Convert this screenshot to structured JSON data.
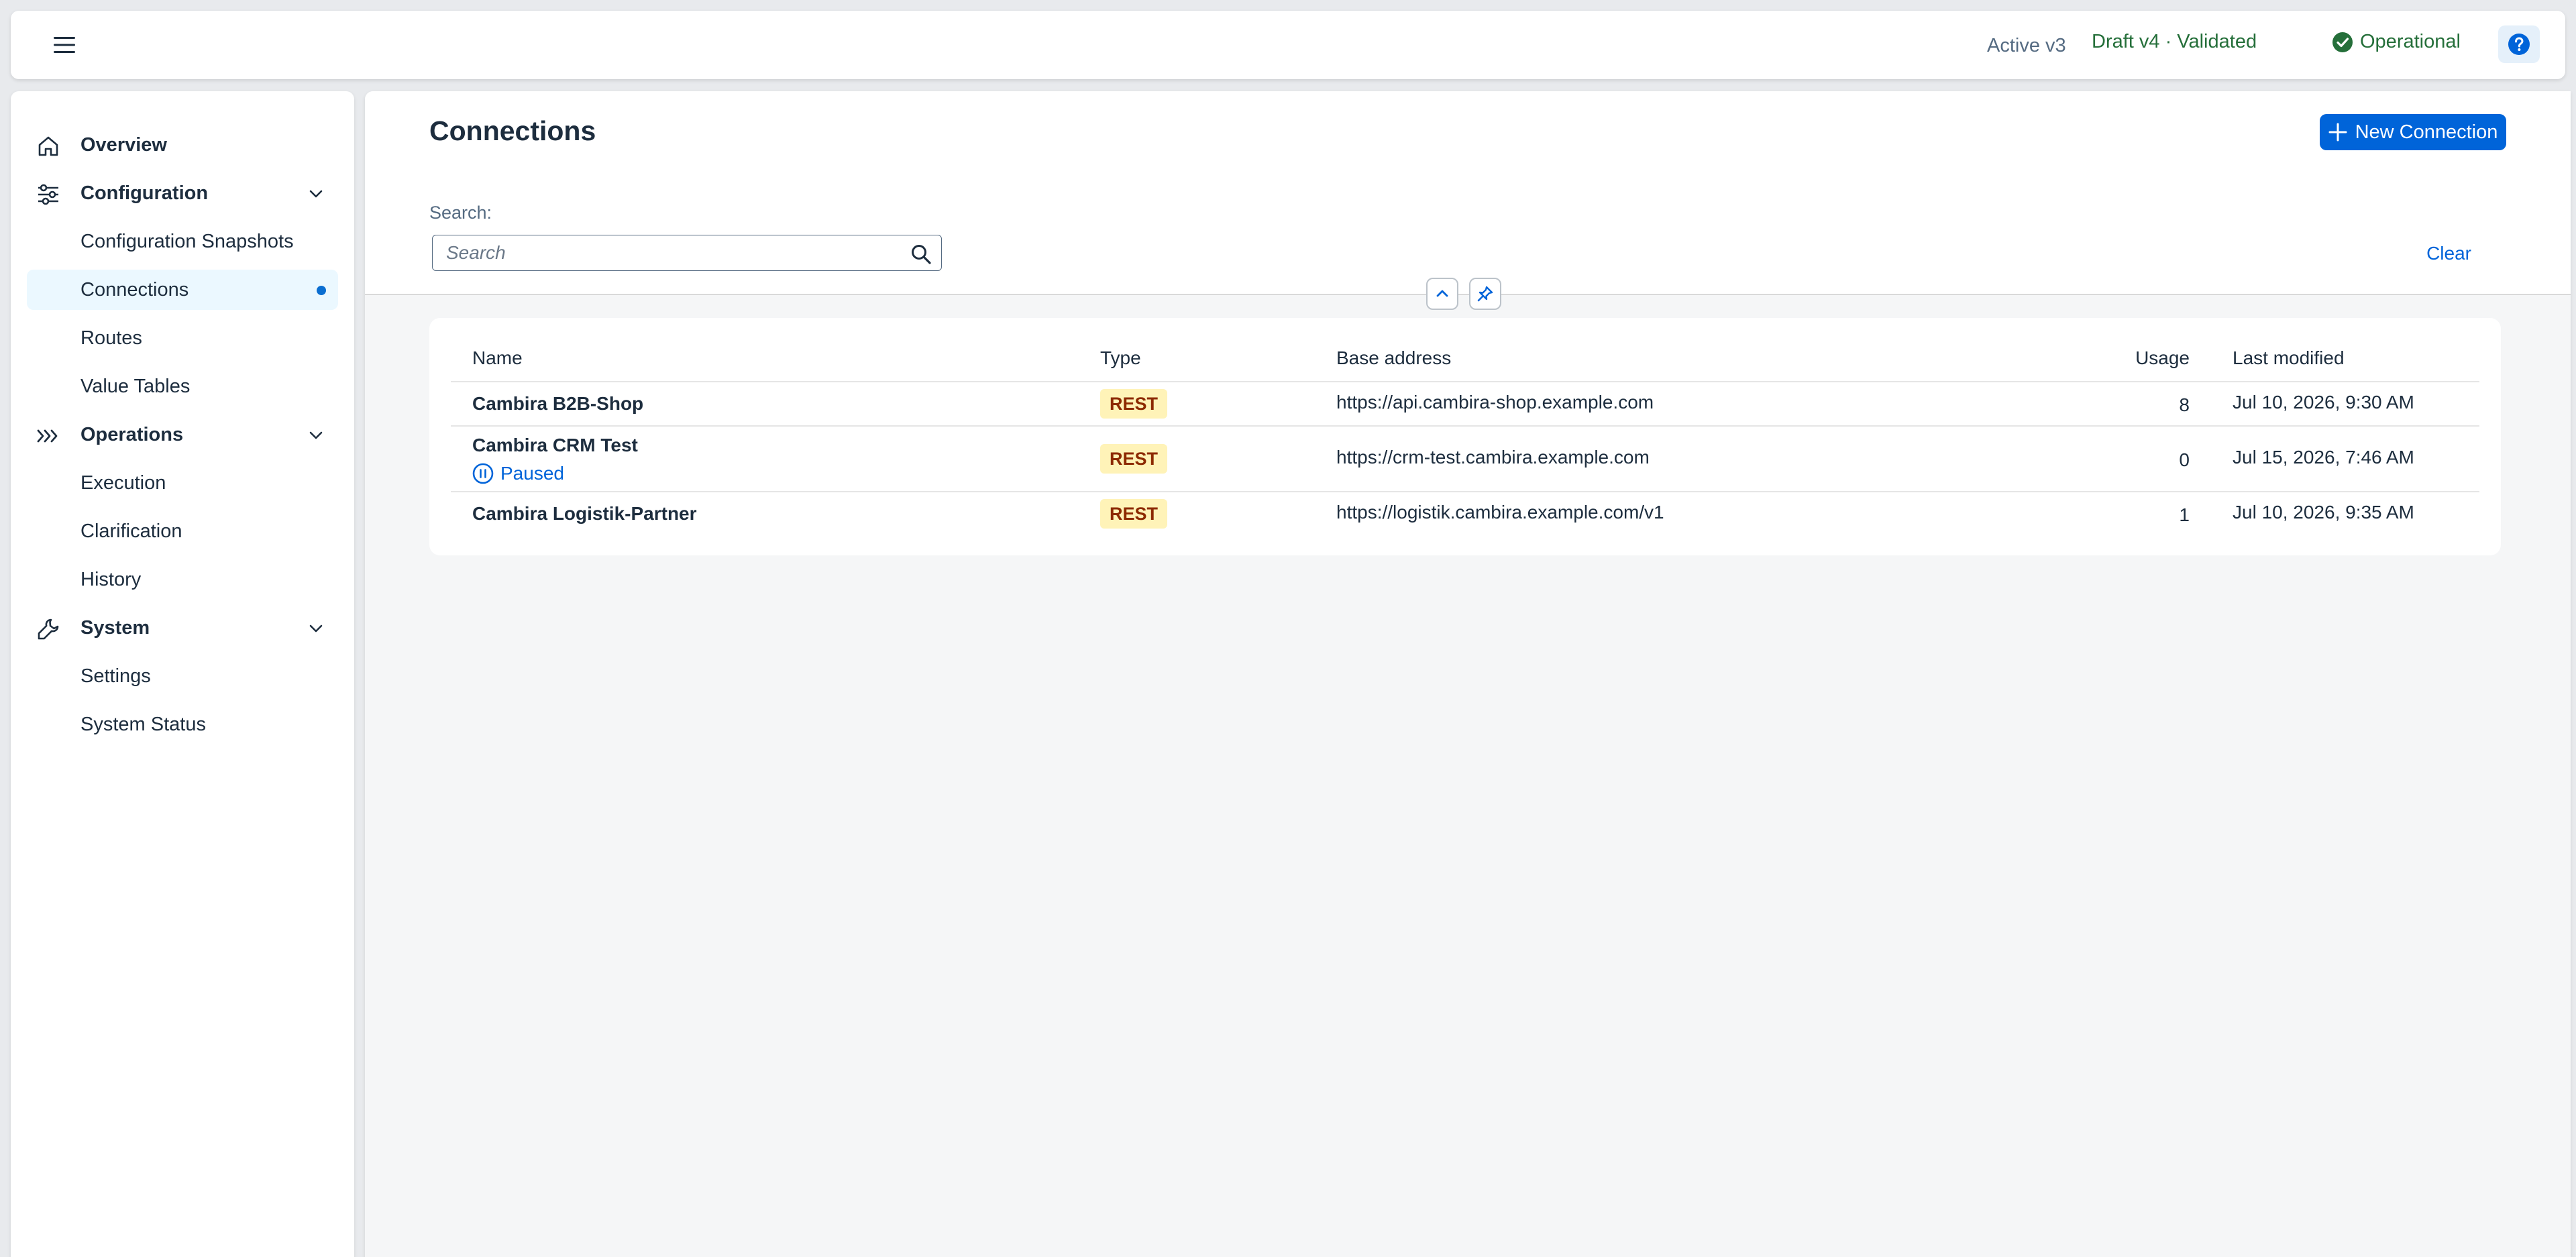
{
  "header": {
    "active_version": "Active v3",
    "draft_version": "Draft v4 · Validated",
    "status": "Operational"
  },
  "sidebar": {
    "overview": "Overview",
    "configuration": {
      "label": "Configuration",
      "items": [
        "Configuration Snapshots",
        "Connections",
        "Routes",
        "Value Tables"
      ]
    },
    "operations": {
      "label": "Operations",
      "items": [
        "Execution",
        "Clarification",
        "History"
      ]
    },
    "system": {
      "label": "System",
      "items": [
        "Settings",
        "System Status"
      ]
    },
    "selected": "Connections"
  },
  "main": {
    "title": "Connections",
    "new_button": "New Connection",
    "search_label": "Search:",
    "search_placeholder": "Search",
    "clear_label": "Clear"
  },
  "table": {
    "columns": {
      "name": "Name",
      "type": "Type",
      "base_address": "Base address",
      "usage": "Usage",
      "last_modified": "Last modified"
    },
    "rows": [
      {
        "name": "Cambira B2B-Shop",
        "type": "REST",
        "base_address": "https://api.cambira-shop.example.com",
        "usage": "8",
        "last_modified": "Jul 10, 2026, 9:30 AM"
      },
      {
        "name": "Cambira CRM Test",
        "status": "Paused",
        "type": "REST",
        "base_address": "https://crm-test.cambira.example.com",
        "usage": "0",
        "last_modified": "Jul 15, 2026, 7:46 AM"
      },
      {
        "name": "Cambira Logistik-Partner",
        "type": "REST",
        "base_address": "https://logistik.cambira.example.com/v1",
        "usage": "1",
        "last_modified": "Jul 10, 2026, 9:35 AM"
      }
    ]
  },
  "colors": {
    "accent": "#0064d9",
    "success": "#256f3a",
    "tag_bg": "#fff3b8",
    "tag_text": "#8d2a00",
    "selected_bg": "#ebf8ff"
  },
  "icons": {
    "menu": "hamburger-icon",
    "status": "check-circle-icon",
    "help": "question-icon",
    "overview": "home-icon",
    "configuration": "sliders-icon",
    "operations": "double-chevron-right-icon",
    "system": "wrench-icon",
    "add": "plus-icon",
    "search": "search-icon",
    "collapse": "chevron-up-icon",
    "pin": "pin-icon",
    "paused": "pause-circle-icon"
  }
}
